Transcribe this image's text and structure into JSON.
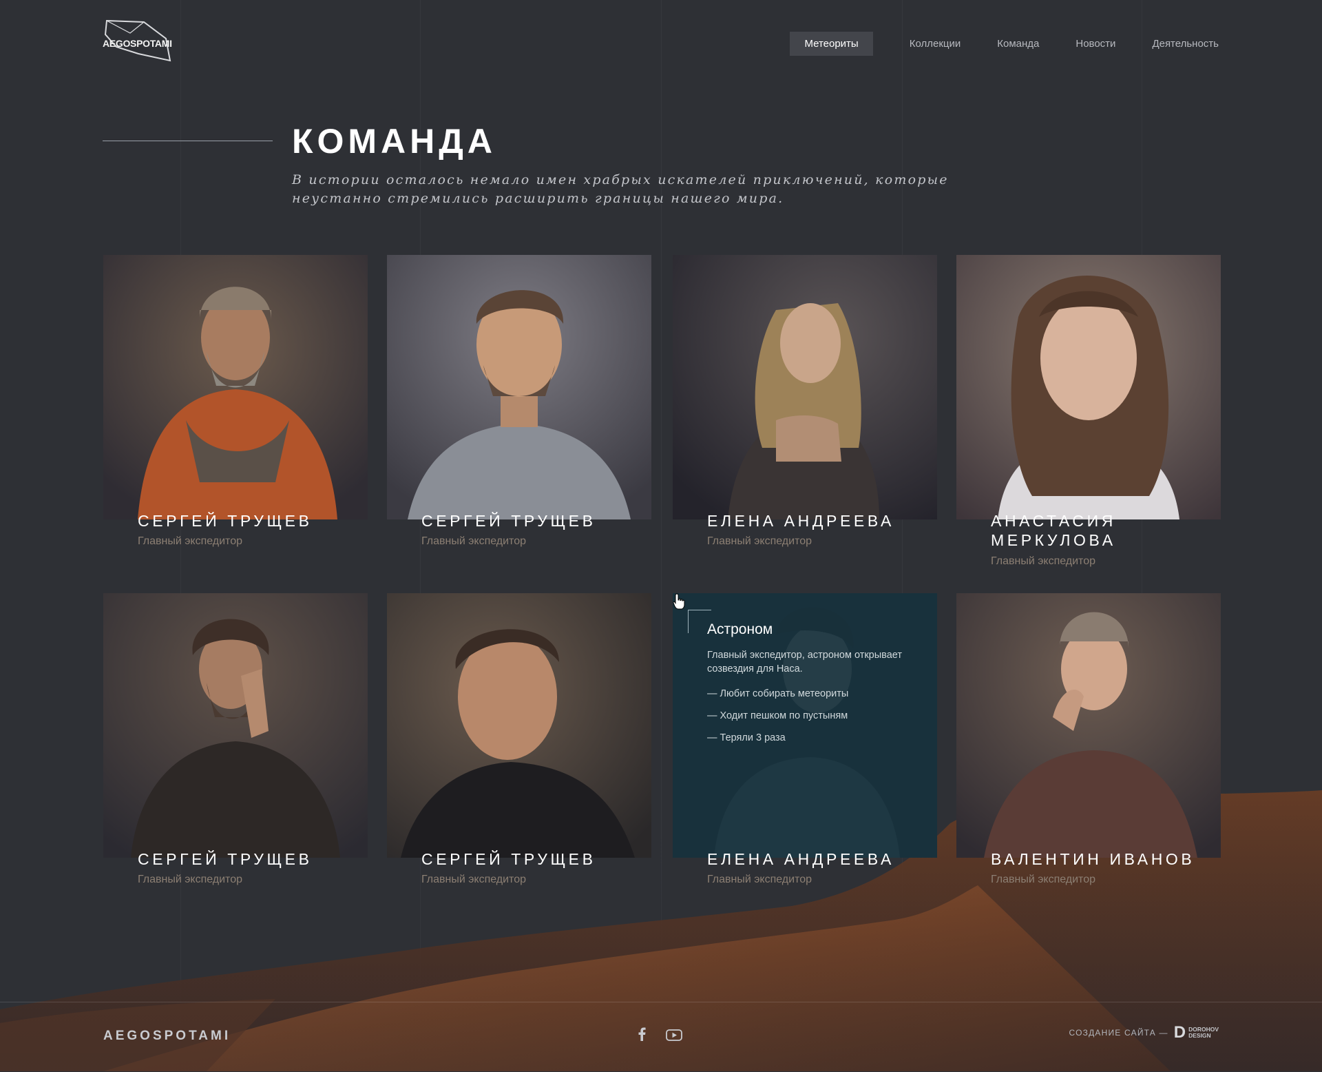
{
  "header": {
    "logo_text": "AEGOSPOTAMI",
    "nav": [
      "Метеориты",
      "Коллекции",
      "Команда",
      "Новости",
      "Деятельность"
    ],
    "active_nav": "Метеориты"
  },
  "hero": {
    "title": "КОМАНДА",
    "subtitle": "В истории осталось немало имен храбрых искателей приключений, которые неустанно стремились расширить границы нашего мира."
  },
  "team": [
    {
      "name": "СЕРГЕЙ ТРУЩЕВ",
      "role": "Главный экспедитор"
    },
    {
      "name": "СЕРГЕЙ ТРУЩЕВ",
      "role": "Главный экспедитор"
    },
    {
      "name": "ЕЛЕНА АНДРЕЕВА",
      "role": "Главный экспедитор"
    },
    {
      "name": "АНАСТАСИЯ МЕРКУЛОВА",
      "role": "Главный экспедитор"
    },
    {
      "name": "СЕРГЕЙ ТРУЩЕВ",
      "role": "Главный экспедитор"
    },
    {
      "name": "СЕРГЕЙ ТРУЩЕВ",
      "role": "Главный экспедитор"
    },
    {
      "name": "ЕЛЕНА АНДРЕЕВА",
      "role": "Главный экспедитор"
    },
    {
      "name": "ВАЛЕНТИН ИВАНОВ",
      "role": "Главный экспедитор"
    }
  ],
  "hover_card": {
    "title": "Астроном",
    "description": "Главный экспедитор, астроном открывает созвездия для Наса.",
    "facts": [
      "Любит собирать метеориты",
      "Ходит пешком по пустыням",
      "Теряли 3 раза"
    ]
  },
  "footer": {
    "logo_text": "AEGOSPOTAMI",
    "social": [
      "facebook-icon",
      "youtube-icon"
    ],
    "credits_label": "СОЗДАНИЕ САЙТА —",
    "credits_brand_line1": "DOROHOV",
    "credits_brand_line2": "DESIGN",
    "credits_brand_mark": "D"
  },
  "colors": {
    "background": "#2e3035",
    "overlay": "#15313d",
    "role_text": "#8c7f73",
    "dune": "#8a5230"
  }
}
